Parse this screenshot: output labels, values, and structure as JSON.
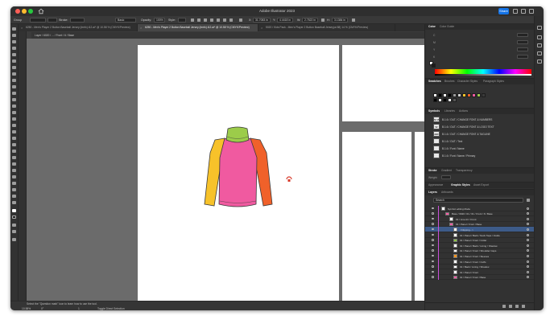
{
  "app": {
    "title": "Adobe Illustrator 2023",
    "share_label": "Share"
  },
  "control_bar": {
    "selection_label": "Group",
    "stroke_label": "Stroke:",
    "stroke_style": "Basic",
    "opacity_label": "Opacity:",
    "opacity_value": "100%",
    "style_label": "Style:",
    "x_label": "X:",
    "x_value": "31.7083 in",
    "y_label": "Y:",
    "y_value": "4.4418 in",
    "w_label": "W:",
    "w_value": "2.7522 in",
    "h_label": "H:",
    "h_value": "3.1384 in"
  },
  "tabs": [
    {
      "label": "6250 - Men's Player 2 Button Baseball Jersey (lmrfc).t12.ai* @ 10.58 % (CMYK/Preview)",
      "active": false
    },
    {
      "label": "6250 - Men's Player 2 Button Baseball Jersey (lmrfc).t12.ai* @ 10.58 % (CMYK/Preview)",
      "active": true
    },
    {
      "label": "5020 / Kids Pack - Men's Player 2 Button Baseball Jersey(ai 88) 14 % (CMYK/Preview)",
      "active": false
    }
  ],
  "breadcrumb": "Layer / 6020 / ... / Front / 6 / Base",
  "status_bar": {
    "tip": "Select the \"Question mark\" icon to learn how to use the tool.",
    "zoom": "10.58%",
    "rotation": "0°",
    "artboard_number": "1",
    "tool_name": "Toggle Direct Selection"
  },
  "panels": {
    "color": {
      "tabs": [
        "Color",
        "Color Guide"
      ],
      "channels": [
        "C",
        "M",
        "Y",
        "K"
      ]
    },
    "swatches": {
      "tabs": [
        "Swatches",
        "Brushes",
        "Character Styles",
        "Paragraph Styles"
      ]
    },
    "symbols": {
      "tabs": [
        "Symbols",
        "Libraries",
        "Actions"
      ],
      "items": [
        {
          "thumb": "52 15",
          "label": "B.1.6 / OUT / CHANGE FONT & NUMBERS"
        },
        {
          "thumb": "52",
          "label": "B.1.6 / OUT / CHANGE FONT & LOGO TEXT"
        },
        {
          "thumb": "ABC",
          "label": "B.1.6 / OUT / CHANGE FONT & TAGLINE"
        },
        {
          "thumb": "",
          "label": "B.1.6 / OUT / Text"
        },
        {
          "thumb": "",
          "label": "B.1.6 / Font / Name"
        },
        {
          "thumb": "",
          "label": "B.1.6 / Font / Name / Primary"
        }
      ]
    },
    "stroke": {
      "tabs": [
        "Stroke",
        "Gradient",
        "Transparency"
      ],
      "weight_label": "Weight:"
    },
    "appearance": {
      "tabs": [
        "Appearance",
        "Graphic Styles",
        "Asset Export"
      ]
    },
    "layers": {
      "tabs": [
        "Layers",
        "Artboards"
      ],
      "search_placeholder": "Search",
      "rows": [
        {
          "label": "Symbol editing Mode",
          "indent": 0,
          "selected": false,
          "thumb": "#ffffff"
        },
        {
          "label": "Base / 6020 / 01 / 01 / Front / 6 / Base",
          "indent": 1,
          "selected": false,
          "thumb": "#ff5aa5"
        },
        {
          "label": "01 / Line Art / Front",
          "indent": 2,
          "selected": false,
          "thumb": "#ffffff"
        },
        {
          "label": "01 / Panel / Front / Base",
          "indent": 2,
          "selected": false,
          "thumb": "#ff5aa5"
        },
        {
          "label": "<Clipping...>",
          "indent": 3,
          "selected": true,
          "thumb": "#ffffff"
        },
        {
          "label": "01 / Panel / Back / Neck Tape / Inside",
          "indent": 3,
          "selected": false,
          "thumb": "#ffffff"
        },
        {
          "label": "01 / Panel / Front / Collar",
          "indent": 3,
          "selected": false,
          "thumb": "#8cc63f"
        },
        {
          "label": "01 / Panel / Back / Lining / Shadow",
          "indent": 3,
          "selected": false,
          "thumb": "#ffffff"
        },
        {
          "label": "01 / Panel / Front / Shoulder Caps",
          "indent": 3,
          "selected": false,
          "thumb": "#ffffff"
        },
        {
          "label": "01 / Panel / Front / Sleeves",
          "indent": 3,
          "selected": false,
          "thumb": "#f7941d"
        },
        {
          "label": "01 / Panel / Front / Cuffs",
          "indent": 3,
          "selected": false,
          "thumb": "#ffffff"
        },
        {
          "label": "01 / Back / Lining / Shadow",
          "indent": 3,
          "selected": false,
          "thumb": "#ffffff"
        },
        {
          "label": "01 / Panel / Front",
          "indent": 3,
          "selected": false,
          "thumb": "#ffffff"
        },
        {
          "label": "01 / Panel / Front / Base",
          "indent": 3,
          "selected": false,
          "thumb": "#ff5aa5"
        }
      ]
    }
  },
  "garment_colors": {
    "collar": "#9ccc4a",
    "body": "#f05aa0",
    "left_sleeve": "#f7c22a",
    "right_sleeve": "#f0612a",
    "outline": "#3a3a3a"
  }
}
